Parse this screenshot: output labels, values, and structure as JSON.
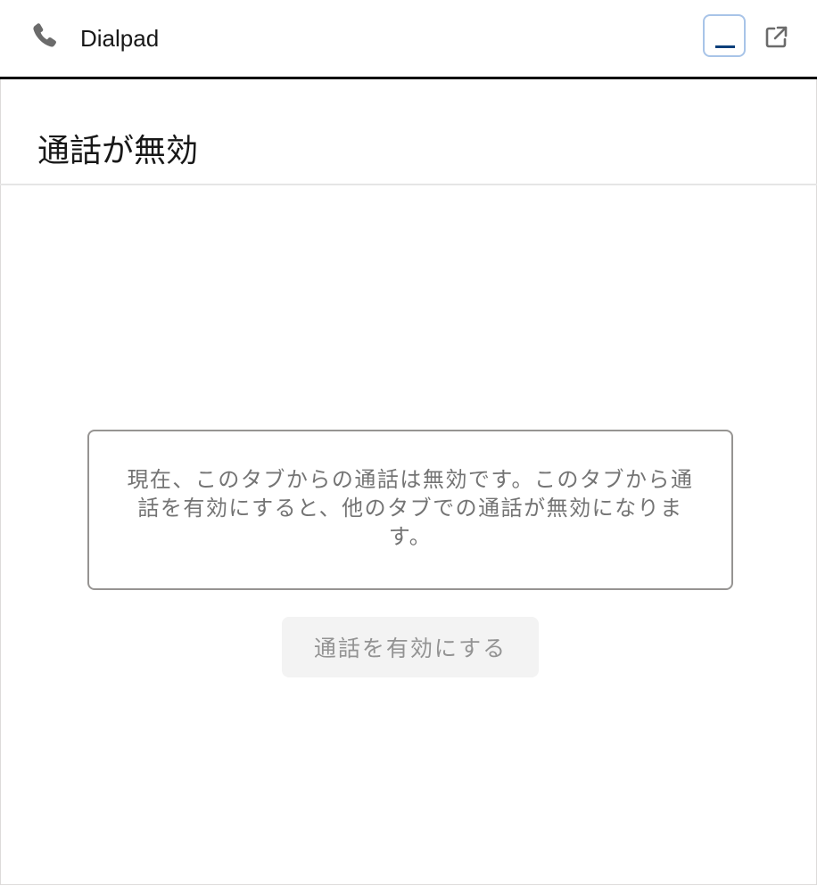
{
  "header": {
    "title": "Dialpad",
    "phone_icon": "phone-icon",
    "minimize_icon": "minimize-icon",
    "popout_icon": "popout-icon"
  },
  "main": {
    "page_title": "通話が無効",
    "message": "現在、このタブからの通話は無効です。このタブから通話を有効にすると、他のタブでの通話が無効になります。",
    "enable_button_label": "通話を有効にする"
  },
  "colors": {
    "header_border": "#000000",
    "focus_ring": "#a8c4e8",
    "minimize_bar": "#0b3f7a",
    "disabled_button_bg": "#f3f3f3",
    "disabled_button_text": "#939393",
    "message_border": "#969492"
  }
}
